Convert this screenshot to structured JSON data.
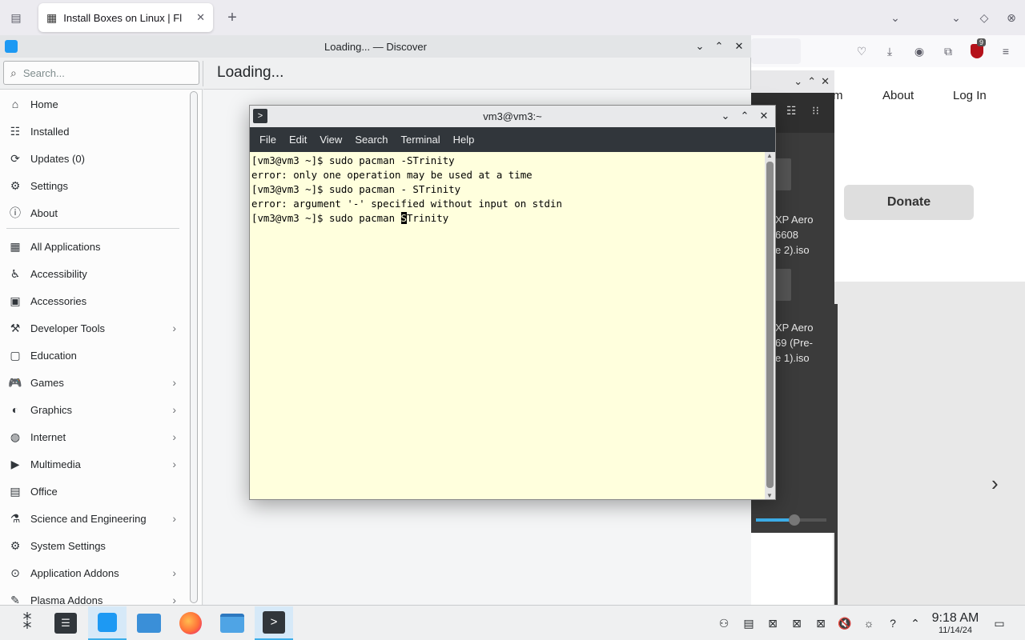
{
  "firefox": {
    "tab_title": "Install Boxes on Linux | Fl",
    "site": {
      "nav_fragment": "m",
      "nav_about": "About",
      "nav_login": "Log In",
      "donate_label": "Donate",
      "notifications_badge": "9"
    }
  },
  "dark_window": {
    "files": [
      {
        "line1": "XP Aero",
        "line2": "6608",
        "line3": "e 2).iso"
      },
      {
        "line1": "XP Aero",
        "line2": "69 (Pre-",
        "line3": "e 1).iso"
      }
    ],
    "slider_value": 0.55
  },
  "discover": {
    "window_title": "Loading... — Discover",
    "search_placeholder": "Search...",
    "page_heading": "Loading...",
    "primary_items": [
      {
        "label": "Home",
        "icon": "home-icon"
      },
      {
        "label": "Installed",
        "icon": "installed-icon"
      },
      {
        "label": "Updates (0)",
        "icon": "updates-icon"
      },
      {
        "label": "Settings",
        "icon": "settings-icon"
      },
      {
        "label": "About",
        "icon": "about-icon"
      }
    ],
    "categories": [
      {
        "label": "All Applications",
        "has_children": false
      },
      {
        "label": "Accessibility",
        "has_children": false
      },
      {
        "label": "Accessories",
        "has_children": false
      },
      {
        "label": "Developer Tools",
        "has_children": true
      },
      {
        "label": "Education",
        "has_children": false
      },
      {
        "label": "Games",
        "has_children": true
      },
      {
        "label": "Graphics",
        "has_children": true
      },
      {
        "label": "Internet",
        "has_children": true
      },
      {
        "label": "Multimedia",
        "has_children": true
      },
      {
        "label": "Office",
        "has_children": false
      },
      {
        "label": "Science and Engineering",
        "has_children": true
      },
      {
        "label": "System Settings",
        "has_children": false
      },
      {
        "label": "Application Addons",
        "has_children": true
      },
      {
        "label": "Plasma Addons",
        "has_children": true
      }
    ]
  },
  "terminal": {
    "window_title": "vm3@vm3:~",
    "menu": [
      "File",
      "Edit",
      "View",
      "Search",
      "Terminal",
      "Help"
    ],
    "lines": [
      "[vm3@vm3 ~]$ sudo pacman -STrinity",
      "error: only one operation may be used at a time",
      "[vm3@vm3 ~]$ sudo pacman - STrinity",
      "error: argument '-' specified without input on stdin"
    ],
    "current_line_before_cursor": "[vm3@vm3 ~]$ sudo pacman ",
    "cursor_char": "S",
    "current_line_after_cursor": "Trinity"
  },
  "taskbar": {
    "time": "9:18 AM",
    "date": "11/14/24"
  },
  "colors": {
    "accent": "#3daee9",
    "terminal_bg": "#ffffdd",
    "terminal_menubar": "#31363b"
  }
}
